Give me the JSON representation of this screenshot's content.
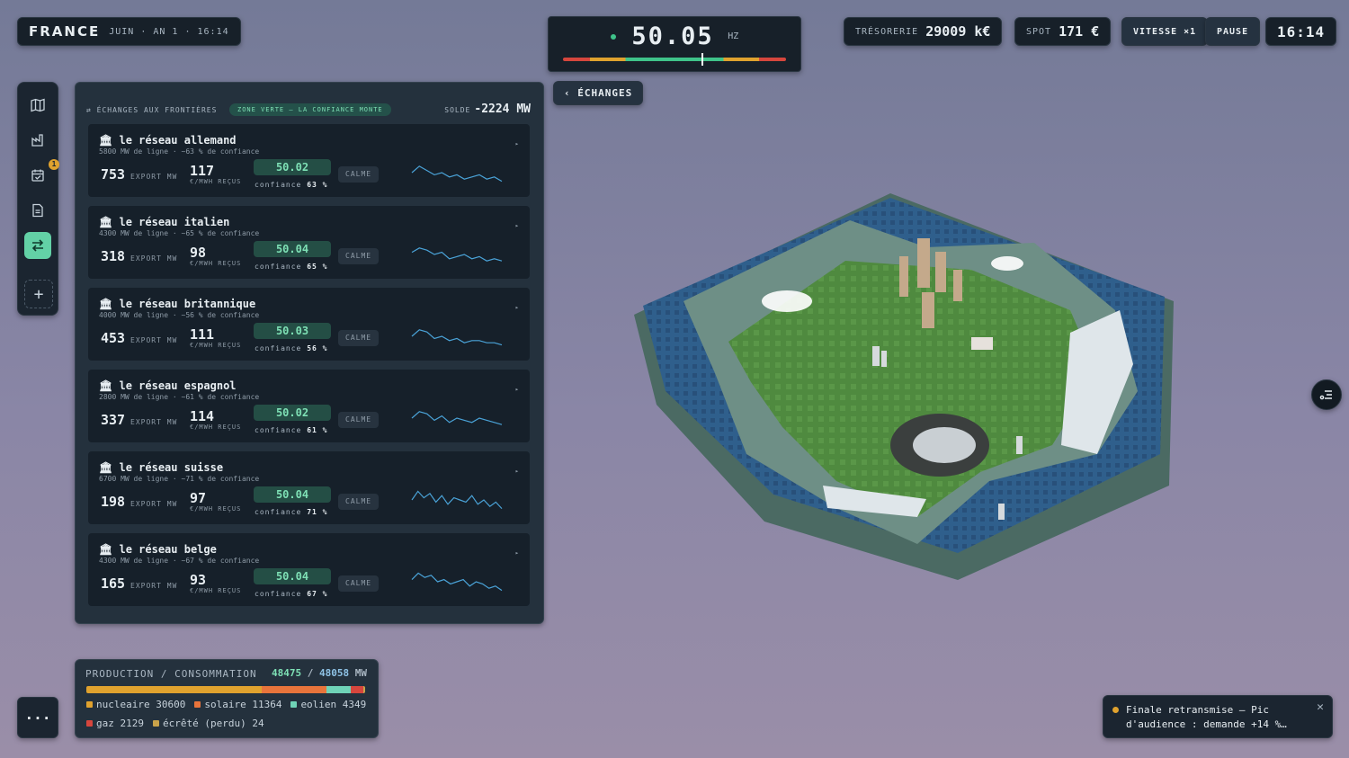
{
  "header": {
    "country": "FRANCE",
    "date": "JUIN · AN 1 · 16:14",
    "frequency": "50.05",
    "frequency_unit": "HZ",
    "frequency_value": 50.05,
    "treasury_label": "TRÉSORERIE",
    "treasury_value": "29009 k€",
    "spot_label": "SPOT",
    "spot_value": "171 €",
    "speed_label": "VITESSE ×1",
    "pause_label": "PAUSE",
    "clock": "16:14"
  },
  "sidebar": {
    "items": [
      {
        "icon": "map-icon"
      },
      {
        "icon": "factory-icon"
      },
      {
        "icon": "calendar-icon",
        "badge": "1"
      },
      {
        "icon": "document-icon"
      },
      {
        "icon": "exchange-icon",
        "active": true
      },
      {
        "icon": "plus-icon"
      }
    ]
  },
  "exchanges": {
    "back_label": "‹ ÉCHANGES",
    "title": "⇄ ÉCHANGES AUX FRONTIÈRES",
    "zone": "ZONE VERTE — LA CONFIANCE MONTE",
    "solde_label": "SOLDE",
    "solde_value": "-2224 MW",
    "export_label": "EXPORT MW",
    "price_label": "€/MWH REÇUS",
    "confidence_label": "confiance",
    "status_label": "CALME",
    "cards": [
      {
        "name": "le réseau allemand",
        "sub": "5800 MW de ligne · ~63 % de confiance",
        "export": "753",
        "price": "117",
        "hz": "50.02",
        "confidence": "63 %"
      },
      {
        "name": "le réseau italien",
        "sub": "4300 MW de ligne · ~65 % de confiance",
        "export": "318",
        "price": "98",
        "hz": "50.04",
        "confidence": "65 %"
      },
      {
        "name": "le réseau britannique",
        "sub": "4000 MW de ligne · ~56 % de confiance",
        "export": "453",
        "price": "111",
        "hz": "50.03",
        "confidence": "56 %"
      },
      {
        "name": "le réseau espagnol",
        "sub": "2800 MW de ligne · ~61 % de confiance",
        "export": "337",
        "price": "114",
        "hz": "50.02",
        "confidence": "61 %"
      },
      {
        "name": "le réseau suisse",
        "sub": "6700 MW de ligne · ~71 % de confiance",
        "export": "198",
        "price": "97",
        "hz": "50.04",
        "confidence": "71 %"
      },
      {
        "name": "le réseau belge",
        "sub": "4300 MW de ligne · ~67 % de confiance",
        "export": "165",
        "price": "93",
        "hz": "50.04",
        "confidence": "67 %"
      }
    ]
  },
  "production": {
    "title": "PRODUCTION / CONSOMMATION",
    "production_value": "48475",
    "separator": "/",
    "consumption_value": "48058",
    "unit": "MW",
    "segments": [
      {
        "label": "nucleaire 30600",
        "value": 30600,
        "color": "#e0a22e"
      },
      {
        "label": "solaire 11364",
        "value": 11364,
        "color": "#e8743b"
      },
      {
        "label": "eolien 4349",
        "value": 4349,
        "color": "#6fd3b7"
      },
      {
        "label": "gaz 2129",
        "value": 2129,
        "color": "#d6463d"
      },
      {
        "label": "écrêté (perdu) 24",
        "value": 24,
        "color": "#c9a34a"
      }
    ]
  },
  "notification": {
    "text": "Finale retransmise — Pic d'audience : demande +14 %…",
    "close": "✕"
  },
  "more_label": "···",
  "colors": {
    "accent": "#63d1a6",
    "panel": "#24313d",
    "card": "#16202a"
  }
}
